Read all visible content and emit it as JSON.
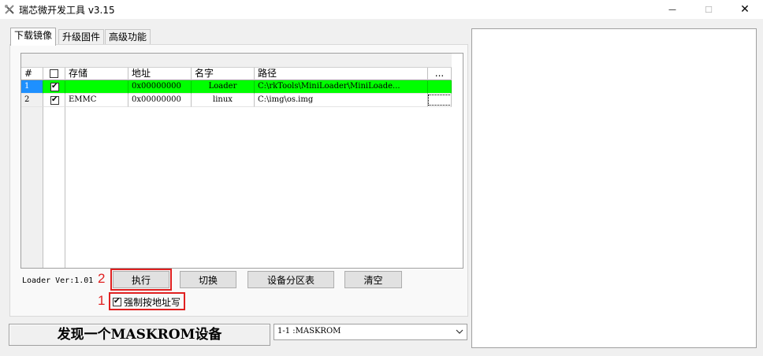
{
  "window": {
    "title": "瑞芯微开发工具 v3.15",
    "minimize": "—",
    "maximize": "☐",
    "close": "✕"
  },
  "tabs": [
    {
      "label": "下载镜像",
      "active": true
    },
    {
      "label": "升级固件",
      "active": false
    },
    {
      "label": "高级功能",
      "active": false
    }
  ],
  "table": {
    "headers": {
      "index": "#",
      "check": "",
      "storage": "存储",
      "address": "地址",
      "name": "名字",
      "path": "路径",
      "more": "..."
    },
    "rows": [
      {
        "index": "1",
        "checked": true,
        "storage": "",
        "address": "0x00000000",
        "name": "Loader",
        "path": "C:\\rkTools\\MiniLoader\\MiniLoade...",
        "selected": true
      },
      {
        "index": "2",
        "checked": true,
        "storage": "EMMC",
        "address": "0x00000000",
        "name": "linux",
        "path": "C:\\img\\os.img",
        "selected": false
      }
    ]
  },
  "bottom": {
    "loader_version": "Loader Ver:1.01",
    "execute_label": "执行",
    "switch_label": "切换",
    "partition_label": "设备分区表",
    "clear_label": "清空",
    "force_write_label": "强制按地址写",
    "annotation_1": "1",
    "annotation_2": "2"
  },
  "status": {
    "message": "发现一个MASKROM设备",
    "device_selected": "1-1 :MASKROM"
  },
  "colors": {
    "selected_row": "#00ff00",
    "annotation_red": "#e02020"
  }
}
